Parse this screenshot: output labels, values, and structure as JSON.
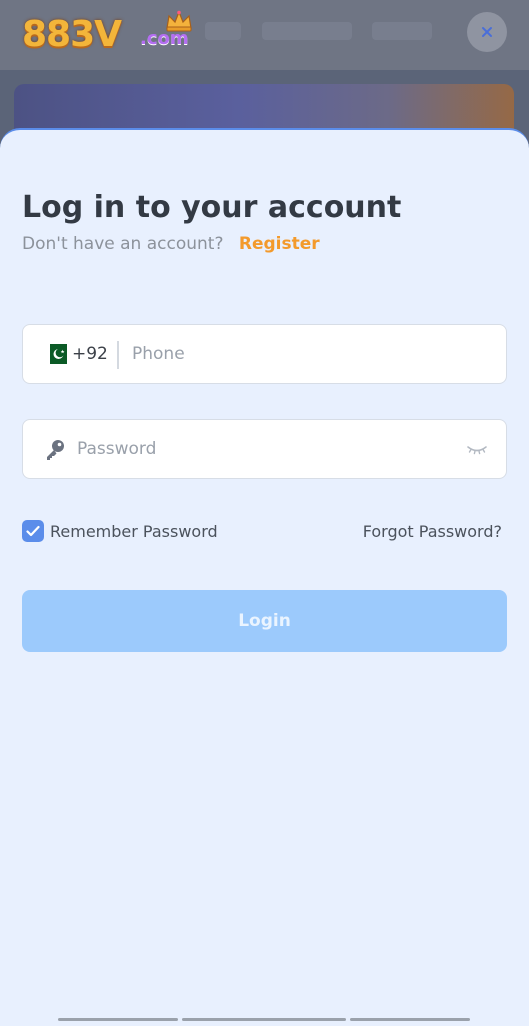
{
  "header": {
    "logo_main": "883V",
    "logo_sub": ".com",
    "close_icon": "close-icon"
  },
  "login": {
    "title": "Log in to your account",
    "no_account_text": "Don't have an account?",
    "register_label": "Register",
    "phone": {
      "flag_icon": "pakistan-flag-icon",
      "country_code": "+92",
      "placeholder": "Phone",
      "value": ""
    },
    "password": {
      "key_icon": "key-icon",
      "placeholder": "Password",
      "value": "",
      "toggle_icon": "eye-closed-icon"
    },
    "remember_label": "Remember Password",
    "remember_checked": true,
    "forgot_label": "Forgot Password?",
    "login_label": "Login"
  },
  "colors": {
    "accent": "#5b8dea",
    "register": "#f39a2c",
    "login_button_disabled": "#9ccafc",
    "sheet_background": "#e8f0fe"
  }
}
